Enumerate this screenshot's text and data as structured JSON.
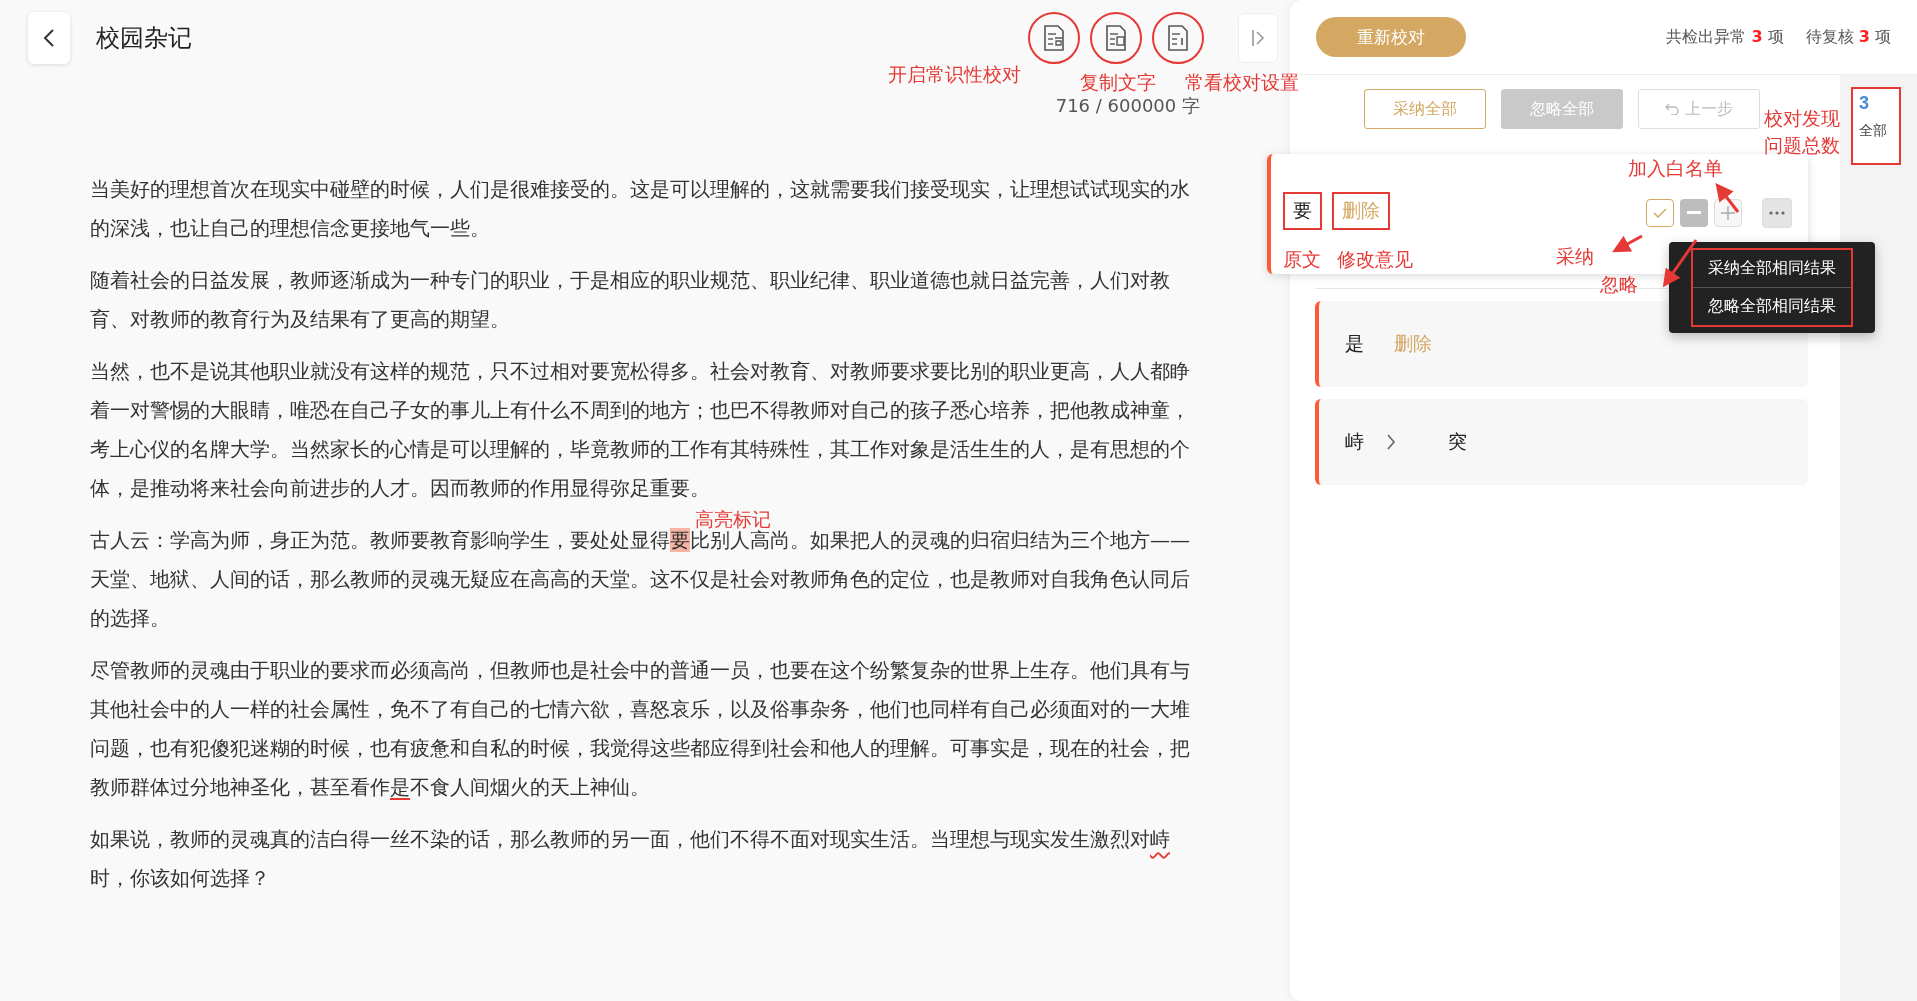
{
  "editor": {
    "title": "校园杂记",
    "word_count": "716 / 600000 字",
    "paragraphs": [
      [
        {
          "kind": "plain",
          "text": "当美好的理想首次在现实中碰壁的时候，人们是很难接受的。这是可以理解的，这就需要我们接受现实，让理想试试现实的水的深浅，也让自己的理想信念更接地气一些。"
        }
      ],
      [
        {
          "kind": "plain",
          "text": "随着社会的日益发展，教师逐渐成为一种专门的职业，于是相应的职业规范、职业纪律、职业道德也就日益完善，人们对教育、对教师的教育行为及结果有了更高的期望。"
        }
      ],
      [
        {
          "kind": "plain",
          "text": "当然，也不是说其他职业就没有这样的规范，只不过相对要宽松得多。社会对教育、对教师要求要比别的职业更高，人人都睁着一对警惕的大眼睛，唯恐在自己子女的事儿上有什么不周到的地方；也巴不得教师对自己的孩子悉心培养，把他教成神童，考上心仪的名牌大学。当然家长的心情是可以理解的，毕竟教师的工作有其特殊性，其工作对象是活生生的人，是有思想的个体，是推动将来社会向前进步的人才。因而教师的作用显得弥足重要。"
        }
      ],
      [
        {
          "kind": "plain",
          "text": "古人云：学高为师，身正为范。教师要教育影响学生，要处处显得"
        },
        {
          "kind": "highlight",
          "text": "要"
        },
        {
          "kind": "plain",
          "text": "比别人高尚。如果把人的灵魂的归宿归结为三个地方——天堂、地狱、人间的话，那么教师的灵魂无疑应在高高的天堂。这不仅是社会对教师角色的定位，也是教师对自我角色认同后的选择。"
        }
      ],
      [
        {
          "kind": "plain",
          "text": "尽管教师的灵魂由于职业的要求而必须高尚，但教师也是社会中的普通一员，也要在这个纷繁复杂的世界上生存。他们具有与其他社会中的人一样的社会属性，免不了有自己的七情六欲，喜怒哀乐，以及俗事杂务，他们也同样有自己必须面对的一大堆问题，也有犯傻犯迷糊的时候，也有疲惫和自私的时候，我觉得这些都应得到社会和他人的理解。可事实是，现在的社会，把教师群体过分地神圣化，甚至看作"
        },
        {
          "kind": "strike",
          "text": "是"
        },
        {
          "kind": "plain",
          "text": "不食人间烟火的天上神仙。"
        }
      ],
      [
        {
          "kind": "plain",
          "text": "如果说，教师的灵魂真的洁白得一丝不染的话，那么教师的另一面，他们不得不面对现实生活。当理想与现实发生激烈对"
        },
        {
          "kind": "wavy",
          "text": "峙"
        },
        {
          "kind": "plain",
          "text": "时，你该如何选择？"
        }
      ]
    ]
  },
  "panel": {
    "recheck_button": "重新校对",
    "stats": [
      {
        "label": "共检出异常",
        "count": "3",
        "unit": "项"
      },
      {
        "label": "待复核",
        "count": "3",
        "unit": "项"
      }
    ],
    "actions": [
      {
        "label": "采纳全部",
        "kind": "outline"
      },
      {
        "label": "忽略全部",
        "kind": "filled"
      },
      {
        "label": "上一步",
        "kind": "disabled"
      }
    ],
    "filter_tab": {
      "count": "3",
      "label": "全部",
      "selected": true
    },
    "issues": [
      {
        "original": "要",
        "suggestion": "删除",
        "kind": "delete",
        "selected": true,
        "menu_items": [
          "采纳全部相同结果",
          "忽略全部相同结果"
        ]
      },
      {
        "original": "是",
        "suggestion": "删除",
        "kind": "delete",
        "selected": false
      },
      {
        "original": "峙",
        "suggestion": "突",
        "kind": "replace",
        "selected": false
      }
    ]
  },
  "annotations": [
    "开启常识性校对",
    "复制文字",
    "常看校对设置",
    "高亮标记",
    "校对发现",
    "问题总数",
    "加入白名单",
    "原文",
    "修改意见",
    "采纳",
    "忽略"
  ]
}
